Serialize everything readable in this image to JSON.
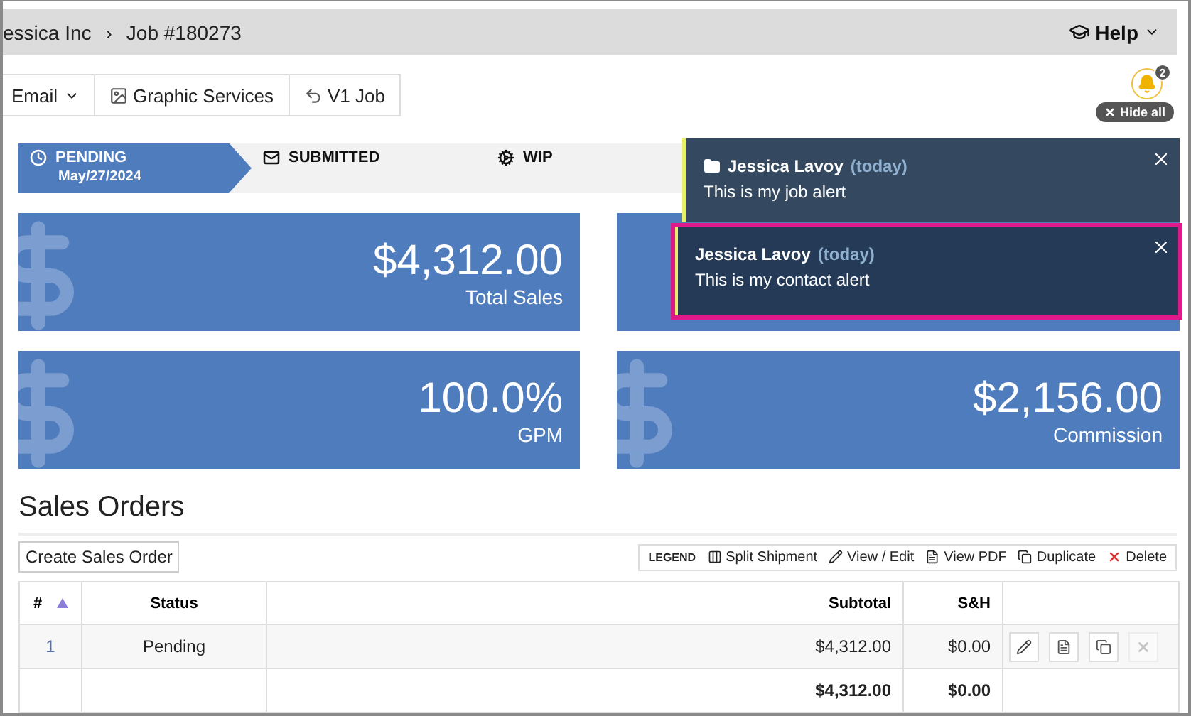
{
  "breadcrumb": [
    "essica Inc",
    "Job #180273"
  ],
  "breadcrumb_separator": "›",
  "help": {
    "label": "Help"
  },
  "toolbar": [
    {
      "kind": "menu",
      "label": "Email"
    },
    {
      "kind": "graphic",
      "label": "Graphic Services"
    },
    {
      "kind": "back",
      "label": "V1 Job"
    }
  ],
  "notifications_badge": {
    "count": "2",
    "hide_label": "Hide all"
  },
  "steps": [
    {
      "label": "PENDING",
      "date": "May/27/2024",
      "selected": true
    },
    {
      "label": "SUBMITTED",
      "selected": false
    },
    {
      "label": "WIP",
      "selected": false
    }
  ],
  "cards_top": [
    {
      "value": "$4,312.00",
      "label": "Total Sales"
    }
  ],
  "cards_bottom": [
    {
      "value": "100.0%",
      "label": "GPM"
    },
    {
      "value": "$2,156.00",
      "label": "Commission"
    }
  ],
  "alerts": [
    {
      "kind": "job",
      "name": "Jessica Lavoy",
      "time": "(today)",
      "message": "This is my job alert",
      "selected": false
    },
    {
      "kind": "contact",
      "name": "Jessica Lavoy",
      "time": "(today)",
      "message": "This is my contact alert",
      "selected": true
    }
  ],
  "section_title": "Sales Orders",
  "create_button": "Create Sales Order",
  "legend": {
    "title": "LEGEND",
    "items": [
      {
        "kind": "split",
        "label": "Split Shipment"
      },
      {
        "kind": "edit",
        "label": "View / Edit"
      },
      {
        "kind": "pdf",
        "label": "View PDF"
      },
      {
        "kind": "duplicate",
        "label": "Duplicate"
      },
      {
        "kind": "delete",
        "label": "Delete"
      }
    ]
  },
  "table": {
    "columns": [
      {
        "label": "#",
        "sorted": true
      },
      {
        "label": "Status",
        "sorted": false
      },
      {
        "label": "Subtotal",
        "sorted": false
      },
      {
        "label": "S&H",
        "sorted": false
      }
    ],
    "rows": [
      {
        "number": "1",
        "status": "Pending",
        "subtotal": "$4,312.00",
        "sh": "$0.00",
        "actions": [
          {
            "kind": "edit",
            "disabled": false
          },
          {
            "kind": "pdf",
            "disabled": false
          },
          {
            "kind": "duplicate",
            "disabled": false
          },
          {
            "kind": "delete",
            "disabled": true
          }
        ]
      }
    ],
    "totals": {
      "subtotal": "$4,312.00",
      "sh": "$0.00"
    }
  }
}
